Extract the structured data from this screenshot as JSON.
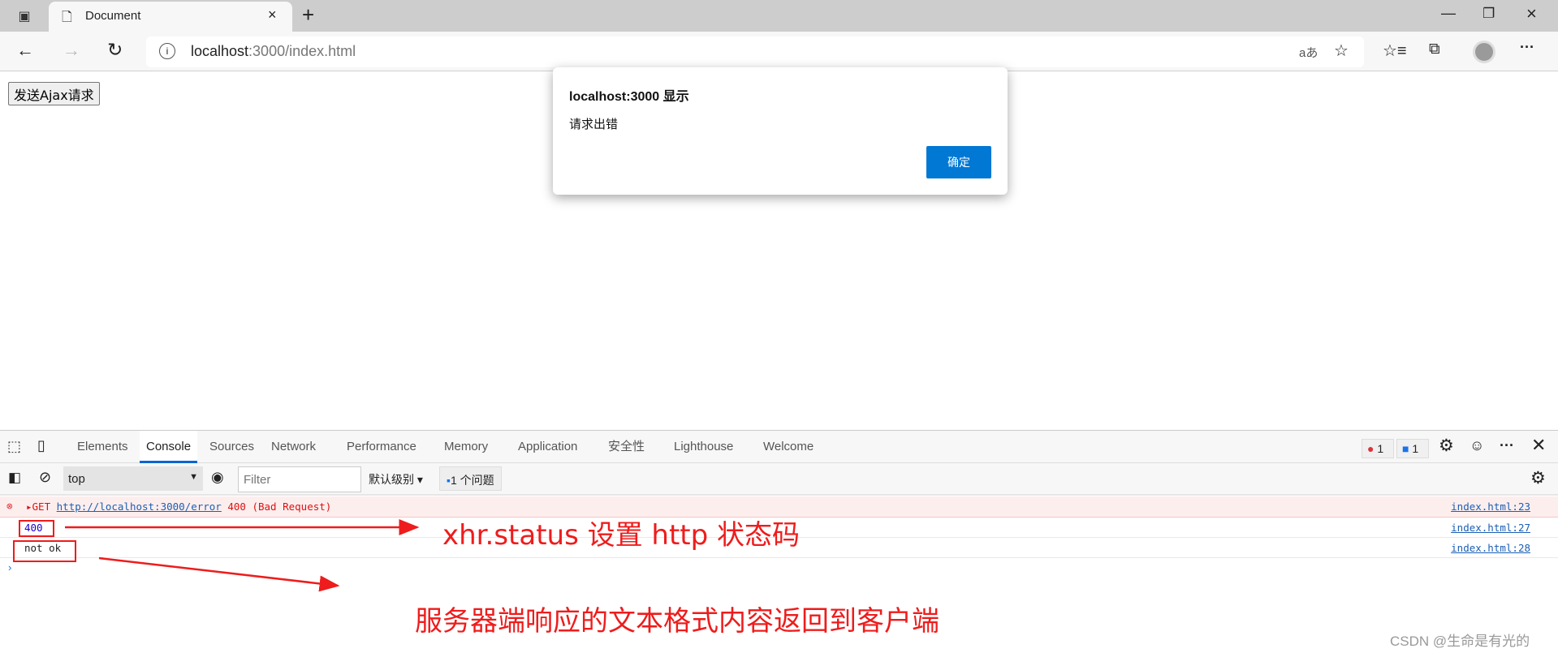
{
  "browser": {
    "tab_title": "Document",
    "url_host": "localhost",
    "url_rest": ":3000/index.html",
    "read_aloud": "aあ"
  },
  "page": {
    "button_label": "发送Ajax请求"
  },
  "alert": {
    "title": "localhost:3000 显示",
    "message": "请求出错",
    "ok_label": "确定",
    "accent": "#0078d4"
  },
  "devtools": {
    "tabs": [
      "Elements",
      "Console",
      "Sources",
      "Network",
      "Performance",
      "Memory",
      "Application",
      "安全性",
      "Lighthouse",
      "Welcome"
    ],
    "active_tab": "Console",
    "error_count": "1",
    "message_count": "1",
    "context": "top",
    "filter_placeholder": "Filter",
    "level": "默认级别",
    "issues": "1 个问题",
    "console": [
      {
        "type": "error",
        "method": "GET",
        "url": "http://localhost:3000/error",
        "status": "400 (Bad Request)",
        "source": "index.html:23"
      },
      {
        "type": "number",
        "text": "400",
        "source": "index.html:27"
      },
      {
        "type": "log",
        "text": "not ok",
        "source": "index.html:28"
      }
    ]
  },
  "annotations": {
    "status_note": "xhr.status 设置 http 状态码",
    "text_note": "服务器端响应的文本格式内容返回到客户端",
    "color": "#ee1c1c"
  },
  "watermark": "CSDN @生命是有光的"
}
